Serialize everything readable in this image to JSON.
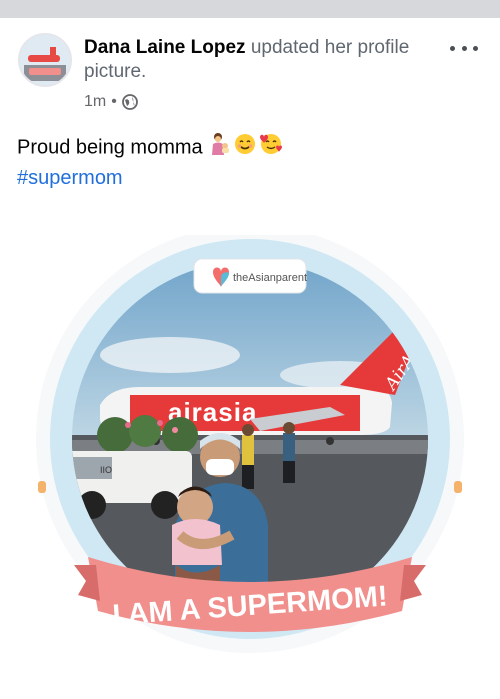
{
  "post": {
    "author": "Dana Laine Lopez",
    "action": "updated her profile picture.",
    "time": "1m",
    "separator": "•",
    "privacy_icon": "globe-icon",
    "more_icon": "more-options-icon"
  },
  "body": {
    "caption": "Proud being momma",
    "emojis": [
      "woman-feeding-baby",
      "smiling-face",
      "smiling-face-with-hearts"
    ],
    "hashtag": "#supermom"
  },
  "photo": {
    "frame_banner": "I AM A SUPERMOM!",
    "badge_text": "theAsianparent",
    "plane_text": "airasia",
    "plane_tail_text": "AirAsia",
    "plane_number": "IIO",
    "colors": {
      "frame_ring": "#cfe8f3",
      "banner": "#f08f8c",
      "accent": "#f36d6d",
      "plane_red": "#e63a3a",
      "hashtag": "#216fdb"
    }
  }
}
